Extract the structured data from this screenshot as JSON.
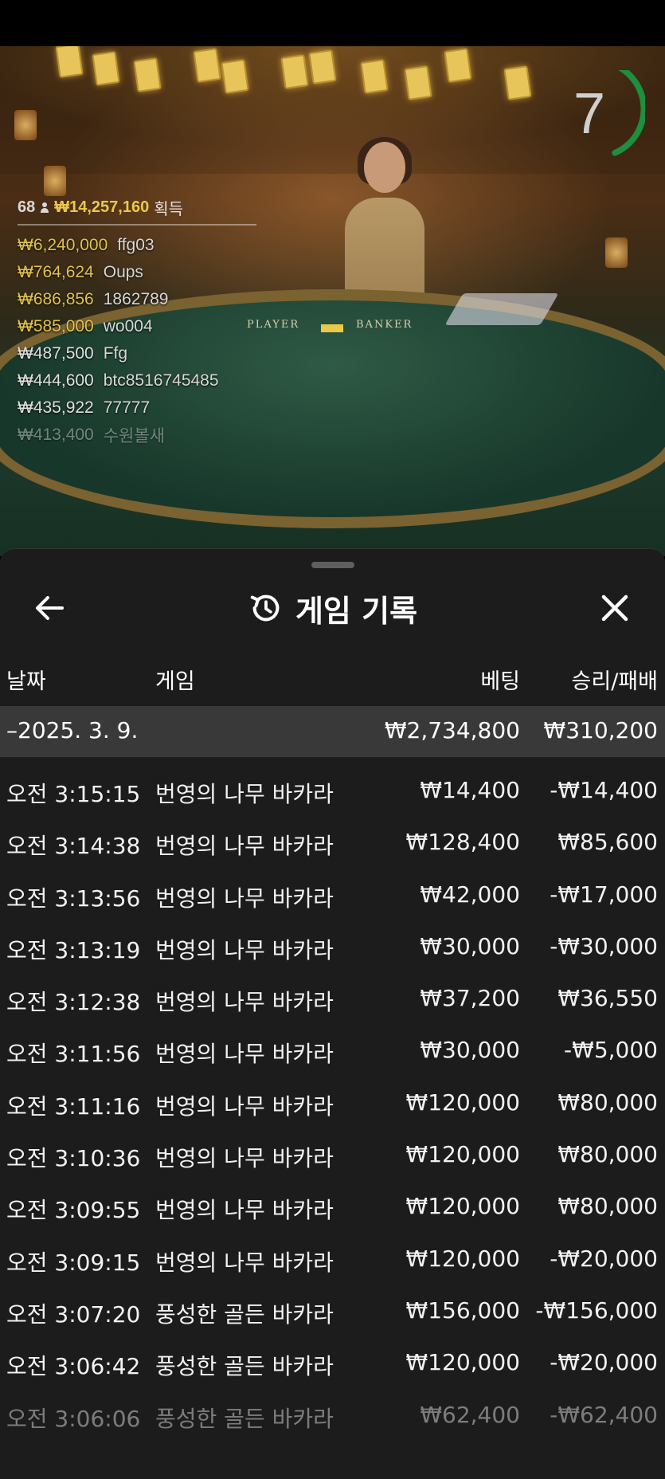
{
  "stream": {
    "timer": "7",
    "table_labels": {
      "player": "PLAYER",
      "banker": "BANKER"
    },
    "leaderboard": {
      "players_count": "68",
      "total": "₩14,257,160",
      "total_suffix": "획득",
      "entries": [
        {
          "amount": "₩6,240,000",
          "name": "ffg03"
        },
        {
          "amount": "₩764,624",
          "name": "Oups"
        },
        {
          "amount": "₩686,856",
          "name": "1862789"
        },
        {
          "amount": "₩585,000",
          "name": "wo004"
        },
        {
          "amount": "₩487,500",
          "name": "Ffg"
        },
        {
          "amount": "₩444,600",
          "name": "btc8516745485"
        },
        {
          "amount": "₩435,922",
          "name": "77777"
        },
        {
          "amount": "₩413,400",
          "name": "수원볼새"
        }
      ]
    }
  },
  "panel": {
    "title": "게임 기록",
    "icons": {
      "back": "arrow-left-icon",
      "history": "history-icon",
      "close": "close-icon"
    },
    "columns": {
      "date": "날짜",
      "game": "게임",
      "bet": "베팅",
      "win_loss": "승리/패배"
    },
    "day": {
      "label": "–2025. 3. 9.",
      "bet": "₩2,734,800",
      "win_loss": "₩310,200"
    },
    "rows": [
      {
        "time": "오전 3:15:15",
        "game": "번영의 나무 바카라",
        "bet": "₩14,400",
        "win_loss": "-₩14,400"
      },
      {
        "time": "오전 3:14:38",
        "game": "번영의 나무 바카라",
        "bet": "₩128,400",
        "win_loss": "₩85,600"
      },
      {
        "time": "오전 3:13:56",
        "game": "번영의 나무 바카라",
        "bet": "₩42,000",
        "win_loss": "-₩17,000"
      },
      {
        "time": "오전 3:13:19",
        "game": "번영의 나무 바카라",
        "bet": "₩30,000",
        "win_loss": "-₩30,000"
      },
      {
        "time": "오전 3:12:38",
        "game": "번영의 나무 바카라",
        "bet": "₩37,200",
        "win_loss": "₩36,550"
      },
      {
        "time": "오전 3:11:56",
        "game": "번영의 나무 바카라",
        "bet": "₩30,000",
        "win_loss": "-₩5,000"
      },
      {
        "time": "오전 3:11:16",
        "game": "번영의 나무 바카라",
        "bet": "₩120,000",
        "win_loss": "₩80,000"
      },
      {
        "time": "오전 3:10:36",
        "game": "번영의 나무 바카라",
        "bet": "₩120,000",
        "win_loss": "₩80,000"
      },
      {
        "time": "오전 3:09:55",
        "game": "번영의 나무 바카라",
        "bet": "₩120,000",
        "win_loss": "₩80,000"
      },
      {
        "time": "오전 3:09:15",
        "game": "번영의 나무 바카라",
        "bet": "₩120,000",
        "win_loss": "-₩20,000"
      },
      {
        "time": "오전 3:07:20",
        "game": "풍성한 골든 바카라",
        "bet": "₩156,000",
        "win_loss": "-₩156,000"
      },
      {
        "time": "오전 3:06:42",
        "game": "풍성한 골든 바카라",
        "bet": "₩120,000",
        "win_loss": "-₩20,000"
      },
      {
        "time": "오전 3:06:06",
        "game": "풍성한 골든 바카라",
        "bet": "₩62,400",
        "win_loss": "-₩62,400"
      }
    ]
  }
}
